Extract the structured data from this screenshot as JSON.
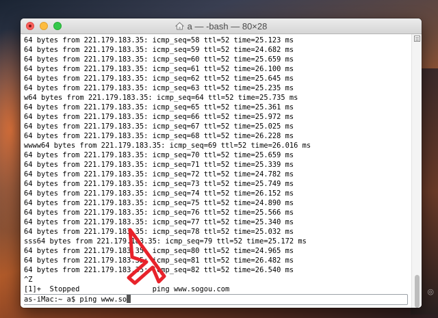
{
  "window": {
    "title": "a — -bash — 80×28"
  },
  "terminal": {
    "lines": [
      "64 bytes from 221.179.183.35: icmp_seq=58 ttl=52 time=25.123 ms",
      "64 bytes from 221.179.183.35: icmp_seq=59 ttl=52 time=24.682 ms",
      "64 bytes from 221.179.183.35: icmp_seq=60 ttl=52 time=25.659 ms",
      "64 bytes from 221.179.183.35: icmp_seq=61 ttl=52 time=26.100 ms",
      "64 bytes from 221.179.183.35: icmp_seq=62 ttl=52 time=25.645 ms",
      "64 bytes from 221.179.183.35: icmp_seq=63 ttl=52 time=25.235 ms",
      "w64 bytes from 221.179.183.35: icmp_seq=64 ttl=52 time=25.735 ms",
      "64 bytes from 221.179.183.35: icmp_seq=65 ttl=52 time=25.361 ms",
      "64 bytes from 221.179.183.35: icmp_seq=66 ttl=52 time=25.972 ms",
      "64 bytes from 221.179.183.35: icmp_seq=67 ttl=52 time=25.025 ms",
      "64 bytes from 221.179.183.35: icmp_seq=68 ttl=52 time=26.228 ms",
      "wwww64 bytes from 221.179.183.35: icmp_seq=69 ttl=52 time=26.016 ms",
      "64 bytes from 221.179.183.35: icmp_seq=70 ttl=52 time=25.659 ms",
      "64 bytes from 221.179.183.35: icmp_seq=71 ttl=52 time=25.339 ms",
      "64 bytes from 221.179.183.35: icmp_seq=72 ttl=52 time=24.782 ms",
      "64 bytes from 221.179.183.35: icmp_seq=73 ttl=52 time=25.749 ms",
      "64 bytes from 221.179.183.35: icmp_seq=74 ttl=52 time=26.152 ms",
      "64 bytes from 221.179.183.35: icmp_seq=75 ttl=52 time=24.890 ms",
      "64 bytes from 221.179.183.35: icmp_seq=76 ttl=52 time=25.566 ms",
      "64 bytes from 221.179.183.35: icmp_seq=77 ttl=52 time=25.340 ms",
      "64 bytes from 221.179.183.35: icmp_seq=78 ttl=52 time=25.032 ms",
      "sss64 bytes from 221.179.183.35: icmp_seq=79 ttl=52 time=25.172 ms",
      "64 bytes from 221.179.183.35: icmp_seq=80 ttl=52 time=24.965 ms",
      "64 bytes from 221.179.183.35: icmp_seq=81 ttl=52 time=26.482 ms",
      "64 bytes from 221.179.183.35: icmp_seq=82 ttl=52 time=26.540 ms",
      "^Z",
      "[1]+  Stopped                 ping www.sogou.com"
    ],
    "prompt": "as-iMac:~ a$ ping www.so"
  },
  "colors": {
    "annotation_arrow": "#e8232b"
  },
  "icons": {
    "title": "home-folder-icon",
    "scroll": "lines-icon"
  }
}
